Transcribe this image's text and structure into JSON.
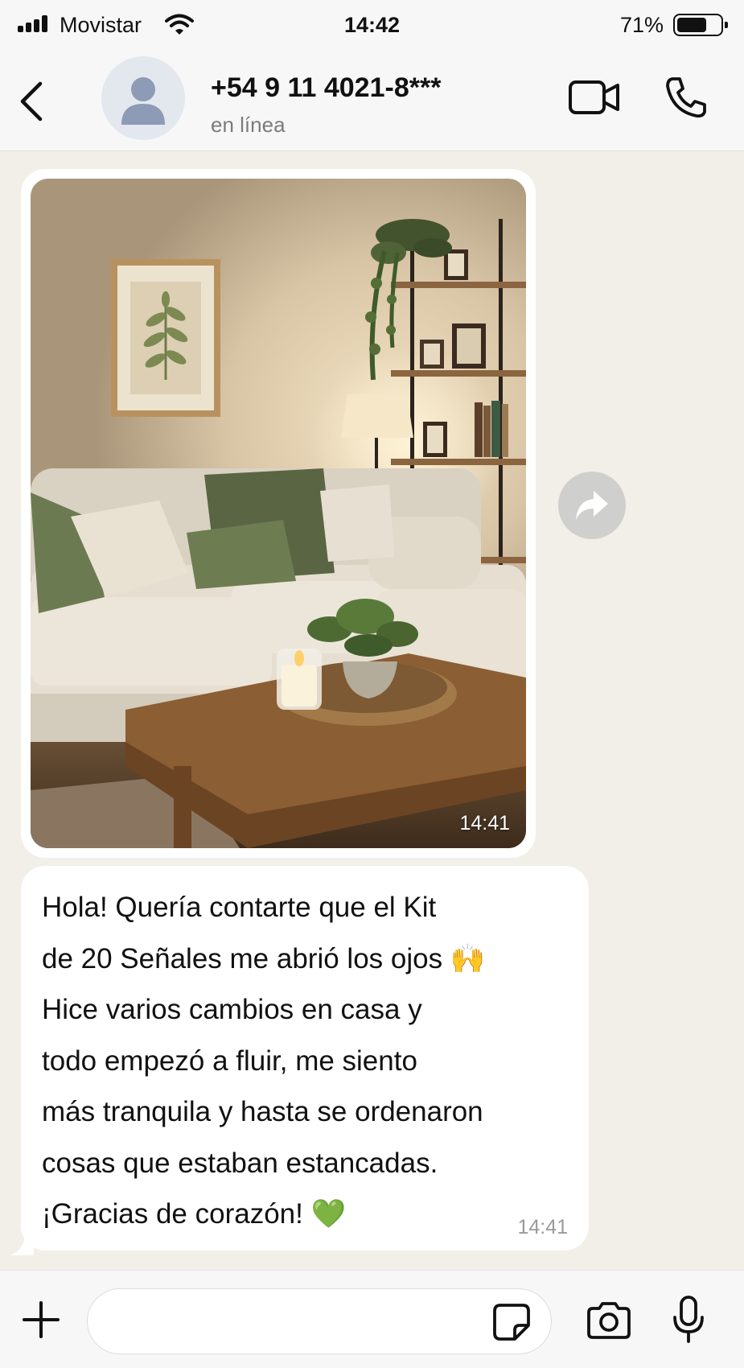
{
  "status_bar": {
    "carrier": "Movistar",
    "time": "14:42",
    "battery_percent": "71%",
    "battery_level": 0.71
  },
  "header": {
    "contact_name": "+54 9 11 4021-8***",
    "contact_status": "en línea",
    "icons": [
      "chevron-left-icon",
      "avatar-person-icon",
      "video-camera-icon",
      "phone-icon"
    ]
  },
  "messages": [
    {
      "type": "image",
      "time": "14:41"
    },
    {
      "type": "text",
      "lines": [
        "Hola! Quería contarte que el Kit",
        "de 20 Señales me abrió los ojos 🙌",
        "Hice varios cambios en casa y",
        "todo empezó a fluir, me siento",
        "más tranquila y hasta se ordenaron",
        "cosas que estaban estancadas.",
        "¡Gracias de corazón! 💚"
      ],
      "time": "14:41"
    }
  ],
  "input_bar": {
    "value": "",
    "placeholder": "",
    "icons": [
      "plus-icon",
      "sticker-icon",
      "camera-icon",
      "microphone-icon"
    ]
  },
  "colors": {
    "chat_background": "#f2efe9",
    "bubble": "#ffffff",
    "bar_background": "#f7f7f7",
    "status_text": "#7b7b7b",
    "timestamp": "#9a9a9a"
  }
}
